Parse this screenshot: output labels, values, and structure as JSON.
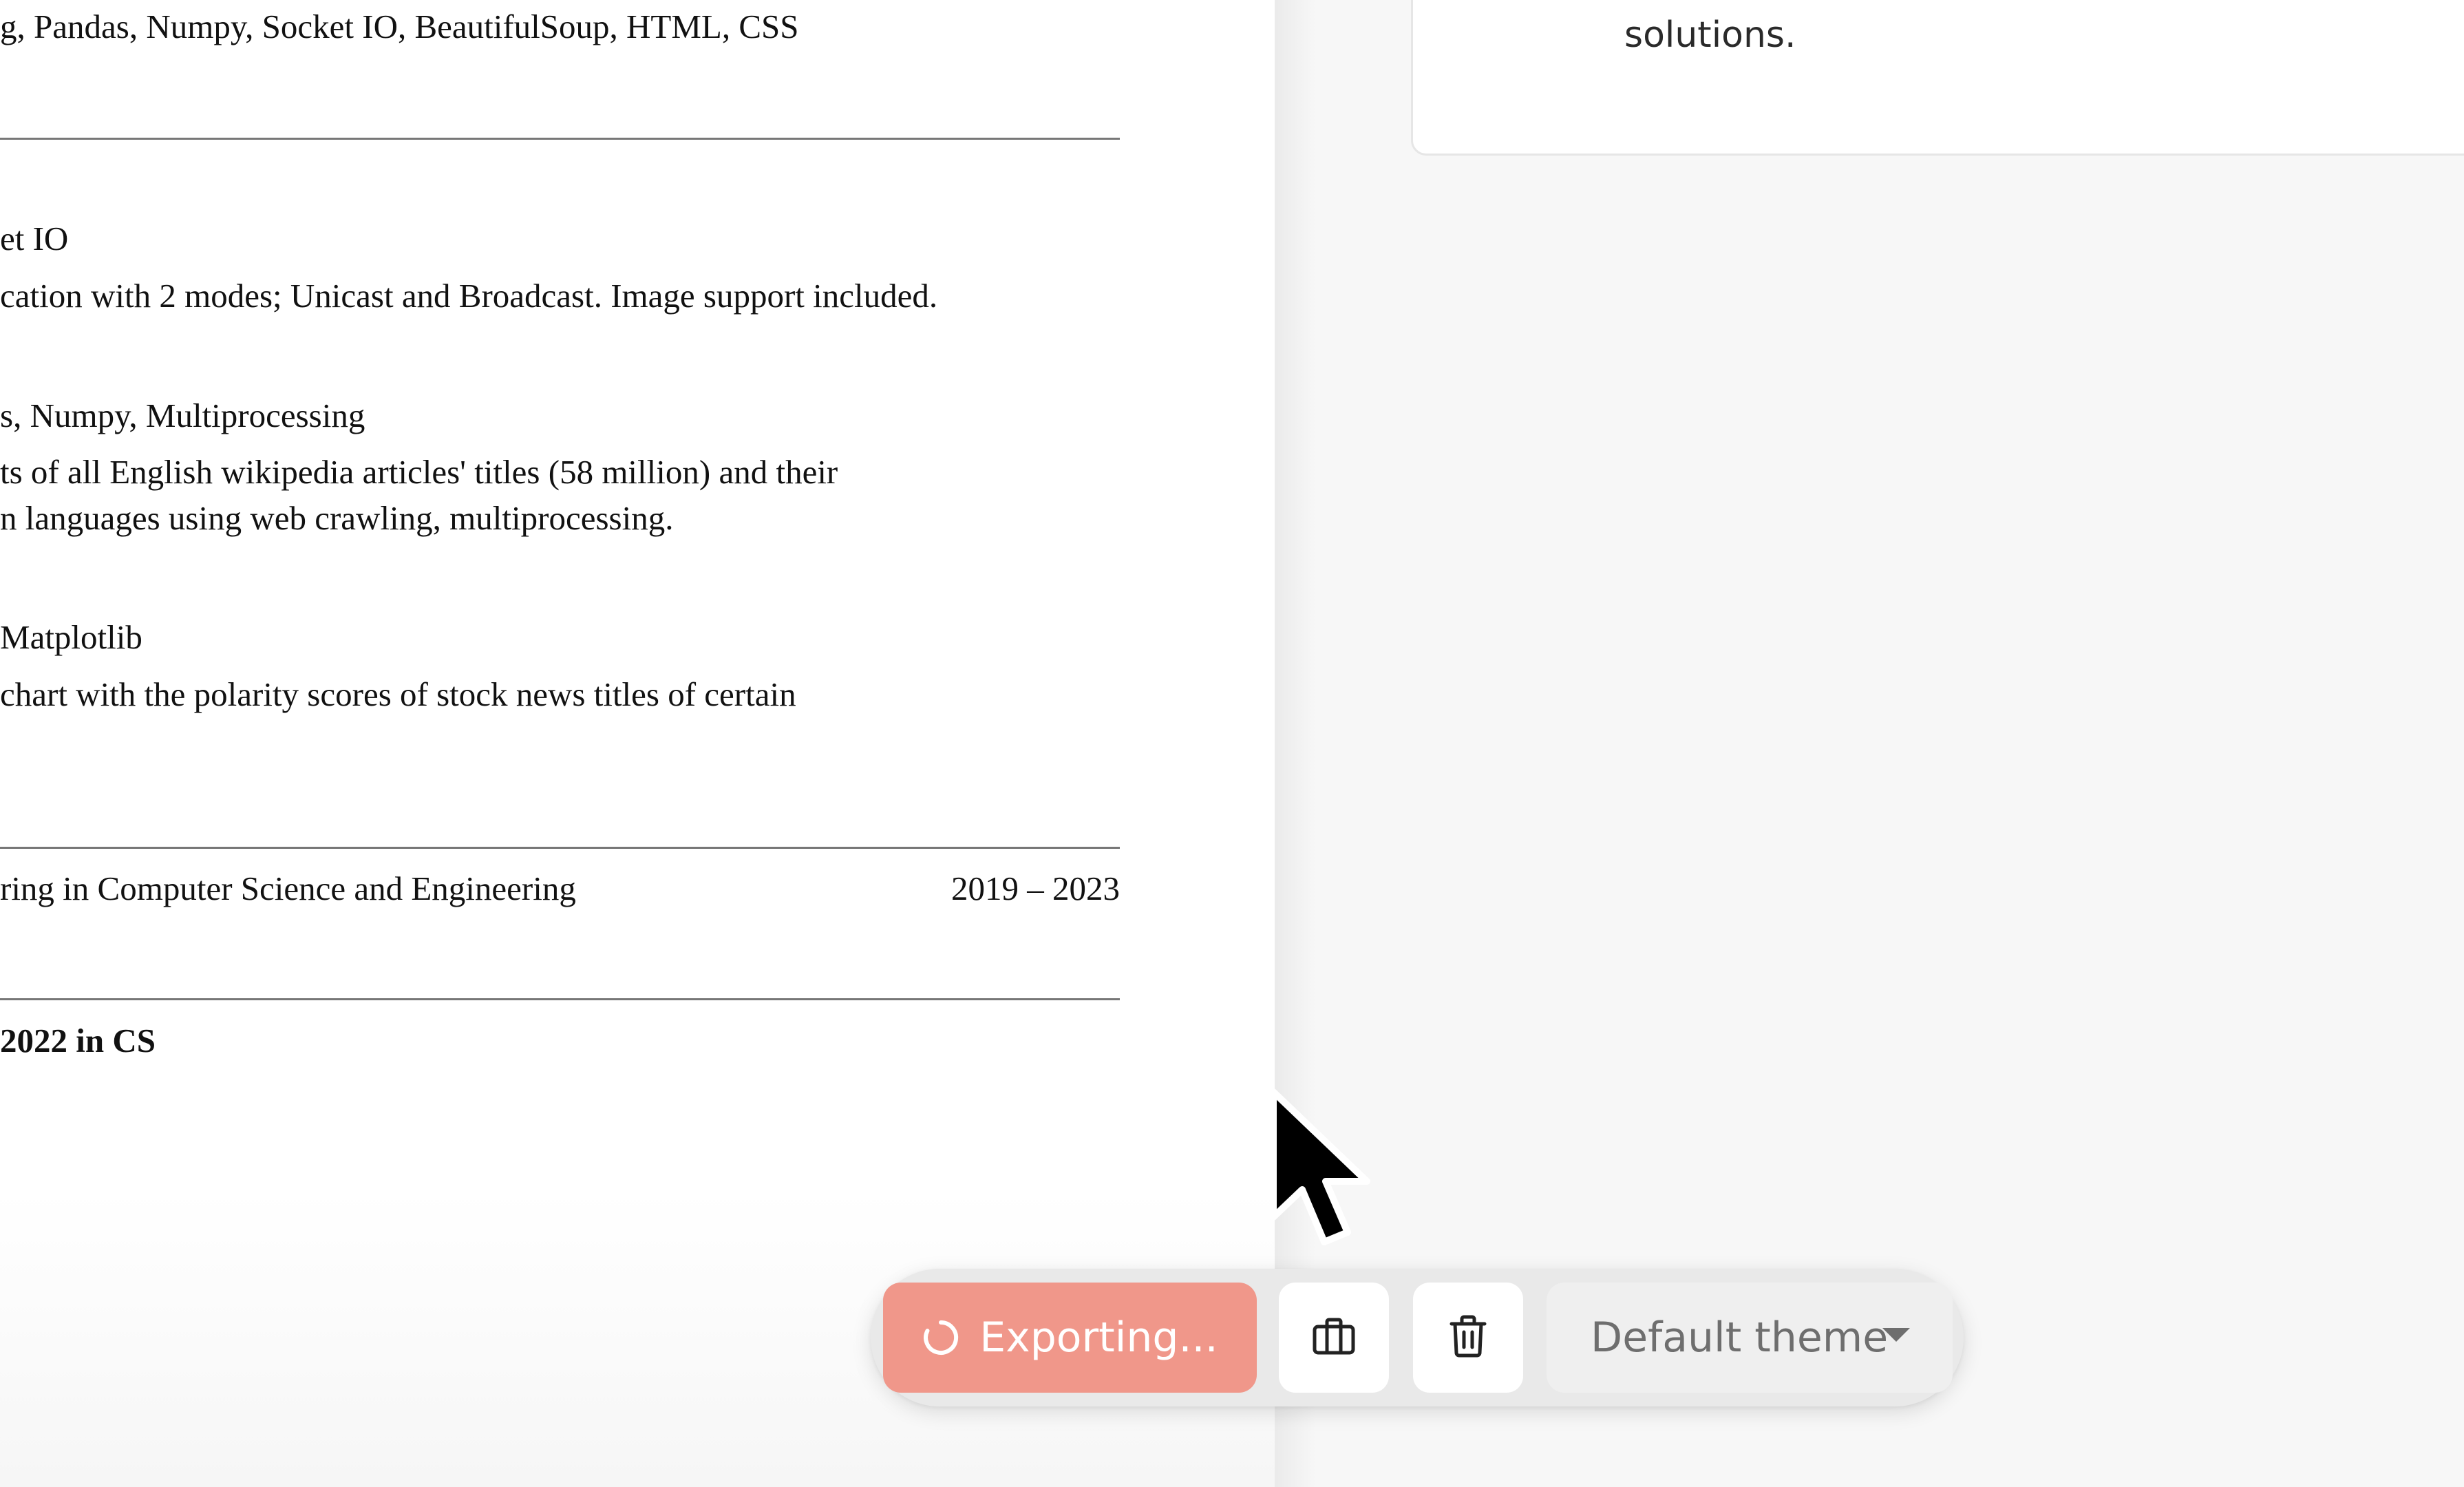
{
  "resume": {
    "skills_line": "g, Pandas, Numpy, Socket IO, BeautifulSoup, HTML, CSS",
    "projects": [
      {
        "tech": "et IO",
        "desc_lines": [
          "cation with 2 modes; Unicast and Broadcast. Image support included."
        ]
      },
      {
        "tech": "s, Numpy, Multiprocessing",
        "desc_lines": [
          "ts of all English wikipedia articles' titles (58 million) and their",
          "n languages using web crawling, multiprocessing."
        ]
      },
      {
        "tech": "Matplotlib",
        "desc_lines": [
          "chart with the polarity scores of stock news titles of certain"
        ]
      }
    ],
    "education": {
      "degree": "ring in Computer Science and Engineering",
      "dates": "2019 – 2023"
    },
    "achievement": "2022 in CS"
  },
  "info_card": {
    "text": "solutions."
  },
  "toolbar": {
    "export_label": "Exporting...",
    "theme_label": "Default theme",
    "icons": {
      "spinner": "loading-spinner-icon",
      "briefcase": "briefcase-icon",
      "trash": "trash-icon",
      "chevron": "chevron-down-icon"
    },
    "colors": {
      "export_bg": "#f0978a",
      "toolbar_bg": "#e9e9e9"
    }
  }
}
